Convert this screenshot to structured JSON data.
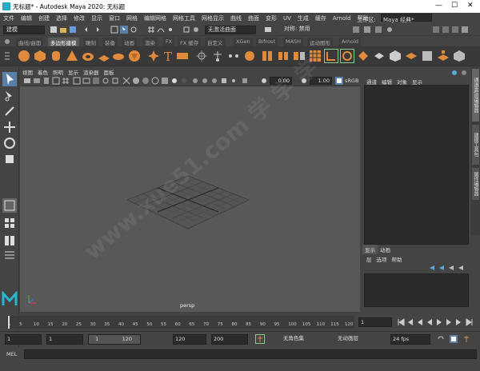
{
  "titlebar": {
    "title": "无标题* - Autodesk Maya 2020: 无标题",
    "minimize": "—",
    "maximize": "☐",
    "close": "✕"
  },
  "menubar": {
    "items": [
      "文件",
      "编辑",
      "创建",
      "选择",
      "修改",
      "显示",
      "窗口",
      "网格",
      "编辑网格",
      "网格工具",
      "网格显示",
      "曲线",
      "曲面",
      "变形",
      "UV",
      "生成",
      "缓存",
      "Arnold",
      "帮助"
    ],
    "workspace_label": "工作区:",
    "workspace_value": "Maya 经典*"
  },
  "statusline": {
    "mode_dropdown": "建模",
    "live_surface": "无激活曲面",
    "symmetry": "对称: 禁用"
  },
  "shelf_tabs": [
    "曲线/曲面",
    "多边形建模",
    "雕刻",
    "装备",
    "动画",
    "渲染",
    "FX",
    "FX 缓存",
    "自定义",
    "XGen",
    "Bifrost",
    "MASH",
    "运动图形",
    "Arnold"
  ],
  "shelf_active_tab": "多边形建模",
  "shelf_icons": [
    "sphere-icon",
    "cube-icon",
    "cylinder-icon",
    "cone-icon",
    "torus-icon",
    "plane-icon",
    "disc-icon",
    "platonic-icon",
    "pyramid-icon",
    "super-shape-icon",
    "sweep-mesh-icon",
    "text-icon",
    "svg-icon",
    "combine-icon",
    "separate-icon",
    "smooth-icon",
    "boolean-icon",
    "mirror-icon",
    "bridge-icon",
    "extrude-icon",
    "bevel-icon",
    "fill-hole-icon",
    "multi-cut-icon",
    "target-weld-icon",
    "crease-icon",
    "quad-draw-icon",
    "uv-editor-icon",
    "planar-uv-icon",
    "auto-uv-icon",
    "cylindrical-uv-icon"
  ],
  "viewport": {
    "menu": [
      "视图",
      "着色",
      "照明",
      "显示",
      "渲染器",
      "面板"
    ],
    "camera_label": "persp",
    "near_value": "0.00",
    "far_value": "1.00",
    "color_space": "sRGB"
  },
  "channelbox": {
    "tabs": [
      "通道",
      "编辑",
      "对象",
      "显示"
    ]
  },
  "layer_editor": {
    "tabs": [
      "显示",
      "动画"
    ],
    "menu": [
      "层",
      "选项",
      "帮助"
    ]
  },
  "side_tabs": [
    "通道盒/层编辑器",
    "建模工具包",
    "属性编辑器"
  ],
  "timeslider": {
    "ticks": [
      "1",
      "5",
      "10",
      "15",
      "20",
      "25",
      "30",
      "35",
      "40",
      "45",
      "50",
      "55",
      "60",
      "65",
      "70",
      "75",
      "80",
      "85",
      "90",
      "95",
      "100",
      "105",
      "110",
      "115",
      "120"
    ],
    "current_frame": "1"
  },
  "rangeslider": {
    "start_time": "1",
    "playback_start": "1",
    "range_start": "1",
    "range_end": "120",
    "playback_end": "120",
    "end_time": "200",
    "character_set": "无角色集",
    "anim_layer": "无动画层",
    "fps": "24 fps"
  },
  "cmdline": {
    "label": "MEL"
  },
  "watermark": "www.xue51.com  学 学 学"
}
